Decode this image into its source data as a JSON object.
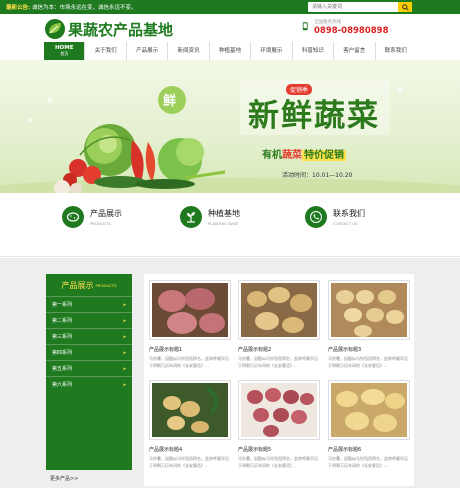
{
  "topbar": {
    "notice_label": "最新公告:",
    "notice_text": "诚信为本：市场永远在变，诚信永远不变。",
    "search_placeholder": "请输入关键词"
  },
  "header": {
    "logo_text": "果蔬农产品基地",
    "hotline_label": "全国服务热线",
    "hotline_number": "0898-08980898"
  },
  "nav": {
    "items": [
      "网站首页",
      "关于我们",
      "产品展示",
      "新闻资讯",
      "种植基地",
      "环境展示",
      "科普知识",
      "客户留言",
      "联系我们"
    ],
    "home": {
      "label": "HOME",
      "sub": "首页"
    }
  },
  "banner": {
    "badge_text": "鲜",
    "tag_text": "促销季",
    "headline": "新鲜蔬菜",
    "subline_1": "有机",
    "subline_2": "蔬菜",
    "subline_3": "特价促销",
    "date_text": "活动时间：10.01—10.20"
  },
  "categories": [
    {
      "title": "产品展示",
      "en": "PRODUCTS",
      "icon": "potato-icon"
    },
    {
      "title": "种植基地",
      "en": "PLANTING BASE",
      "icon": "sprout-icon"
    },
    {
      "title": "联系我们",
      "en": "CONTACT US",
      "icon": "phone-icon"
    }
  ],
  "sidebar": {
    "title": "产品展示",
    "title_en": "PRODUCTS",
    "items": [
      "第一系列",
      "第二系列",
      "第三系列",
      "第四系列",
      "第五系列",
      "第六系列"
    ],
    "more": "更多产品>>"
  },
  "products": [
    {
      "title": "产品展示标题1",
      "desc": "马铃薯，因酷似马铃铛而得名，此称呼最早见于明朝万历年间的《长安客话》..."
    },
    {
      "title": "产品展示标题2",
      "desc": "马铃薯，因酷似马铃铛而得名，此称呼最早见于明朝万历年间的《长安客话》..."
    },
    {
      "title": "产品展示标题3",
      "desc": "马铃薯，因酷似马铃铛而得名，此称呼最早见于明朝万历年间的《长安客话》..."
    },
    {
      "title": "产品展示标题4",
      "desc": "马铃薯，因酷似马铃铛而得名，此称呼最早见于明朝万历年间的《长安客话》..."
    },
    {
      "title": "产品展示标题5",
      "desc": "马铃薯，因酷似马铃铛而得名，此称呼最早见于明朝万历年间的《长安客话》..."
    },
    {
      "title": "产品展示标题6",
      "desc": "马铃薯，因酷似马铃铛而得名，此称呼最早见于明朝万历年间的《长安客话》..."
    }
  ],
  "colors": {
    "brand": "#1f7a1f",
    "accent": "#ffcc00",
    "hotline": "#dd2222"
  }
}
